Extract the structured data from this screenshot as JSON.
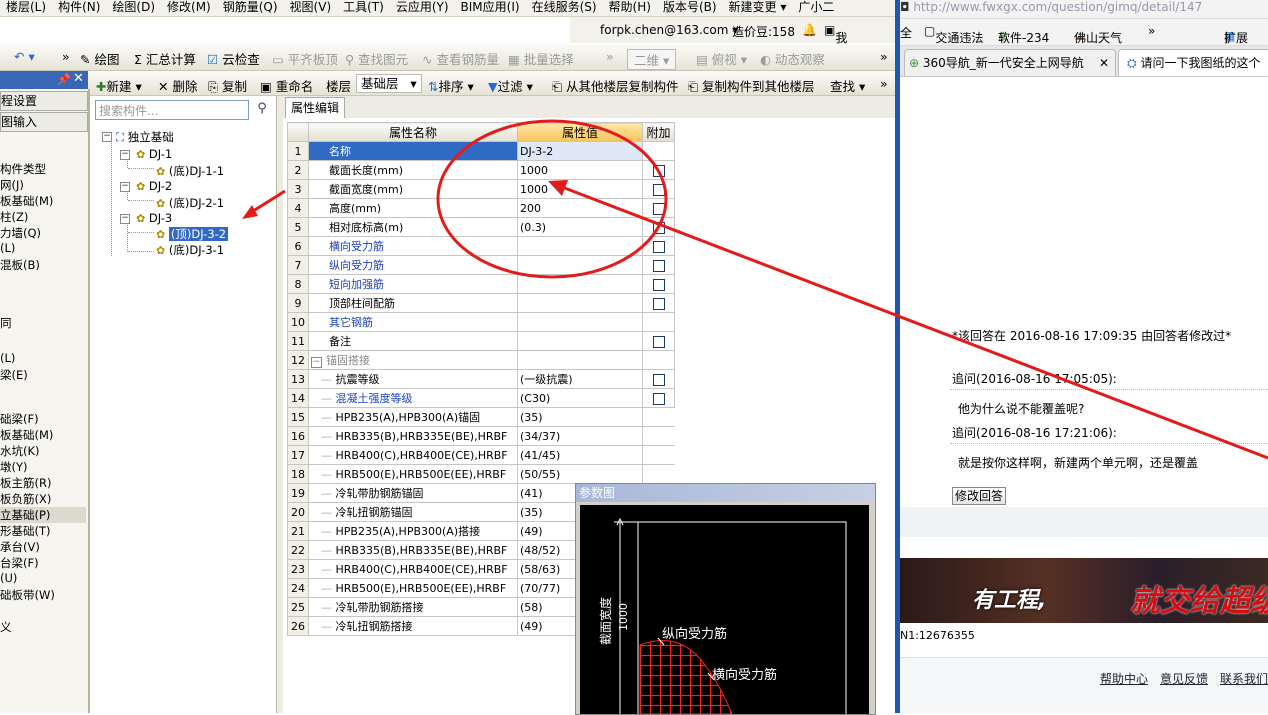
{
  "menubar": [
    "楼层(L)",
    "构件(N)",
    "绘图(D)",
    "修改(M)",
    "钢筋量(Q)",
    "视图(V)",
    "工具(T)",
    "云应用(Y)",
    "BIM应用(I)",
    "在线服务(S)",
    "帮助(H)",
    "版本号(B)",
    "新建变更 ▾",
    "广小二"
  ],
  "userbar": {
    "email": "forpk.chen@163.com ▾",
    "credit": "造价豆:158",
    "suggest": "我要建议"
  },
  "toolbar1": {
    "draw": "绘图",
    "sum": "Σ 汇总计算",
    "cloud_check": "云检查",
    "flat_slab": "平齐板顶",
    "find": "查找图元",
    "view_rebar": "查看钢筋量",
    "batch_select": "批量选择",
    "view_mode": "二维",
    "perspective": "俯视",
    "dynamic": "动态观察"
  },
  "toolbar2": {
    "new": "新建 ▾",
    "delete": "删除",
    "copy": "复制",
    "rename": "重命名",
    "floor_label": "楼层",
    "floor_value": "基础层",
    "sort": "排序 ▾",
    "filter": "过滤 ▾",
    "copy_from": "从其他楼层复制构件",
    "copy_to": "复制构件到其他楼层",
    "find": "查找 ▾"
  },
  "left_panel": {
    "setting": "程设置",
    "input": "图输入",
    "items": [
      "构件类型",
      "网(J)",
      "板基础(M)",
      "柱(Z)",
      "力墙(Q)",
      "(L)",
      "混板(B)",
      "同",
      "(L)",
      "梁(E)",
      "础梁(F)",
      "板基础(M)",
      "水坑(K)",
      "墩(Y)",
      "板主筋(R)",
      "板负筋(X)",
      "立基础(P)",
      "形基础(T)",
      "承台(V)",
      "台梁(F)",
      "(U)",
      "础板带(W)",
      "义"
    ]
  },
  "tree": {
    "search_placeholder": "搜索构件...",
    "root": "独立基础",
    "nodes": [
      "DJ-1",
      "(底)DJ-1-1",
      "DJ-2",
      "(底)DJ-2-1",
      "DJ-3",
      "(顶)DJ-3-2",
      "(底)DJ-3-1"
    ]
  },
  "tab_label": "属性编辑",
  "grid": {
    "headers": {
      "name": "属性名称",
      "value": "属性值",
      "extra": "附加"
    },
    "rows": [
      {
        "n": "1",
        "name": "名称",
        "value": "DJ-3-2",
        "chk": false,
        "style": "sel"
      },
      {
        "n": "2",
        "name": "截面长度(mm)",
        "value": "1000",
        "chk": true,
        "style": ""
      },
      {
        "n": "3",
        "name": "截面宽度(mm)",
        "value": "1000",
        "chk": true,
        "style": ""
      },
      {
        "n": "4",
        "name": "高度(mm)",
        "value": "200",
        "chk": true,
        "style": ""
      },
      {
        "n": "5",
        "name": "相对底标高(m)",
        "value": "(0.3)",
        "chk": true,
        "style": ""
      },
      {
        "n": "6",
        "name": "横向受力筋",
        "value": "",
        "chk": true,
        "style": "blue"
      },
      {
        "n": "7",
        "name": "纵向受力筋",
        "value": "",
        "chk": true,
        "style": "blue"
      },
      {
        "n": "8",
        "name": "短向加强筋",
        "value": "",
        "chk": true,
        "style": "blue"
      },
      {
        "n": "9",
        "name": "顶部柱间配筋",
        "value": "",
        "chk": true,
        "style": ""
      },
      {
        "n": "10",
        "name": "其它钢筋",
        "value": "",
        "chk": false,
        "style": "blue"
      },
      {
        "n": "11",
        "name": "备注",
        "value": "",
        "chk": true,
        "style": ""
      },
      {
        "n": "12",
        "name": "锚固搭接",
        "value": "",
        "chk": false,
        "style": "group"
      },
      {
        "n": "13",
        "name": "抗震等级",
        "value": "(一级抗震)",
        "chk": true,
        "style": "sub"
      },
      {
        "n": "14",
        "name": "混凝土强度等级",
        "value": "(C30)",
        "chk": true,
        "style": "subblue"
      },
      {
        "n": "15",
        "name": "HPB235(A),HPB300(A)锚固",
        "value": "(35)",
        "chk": false,
        "style": "sub"
      },
      {
        "n": "16",
        "name": "HRB335(B),HRB335E(BE),HRBF",
        "value": "(34/37)",
        "chk": false,
        "style": "sub"
      },
      {
        "n": "17",
        "name": "HRB400(C),HRB400E(CE),HRBF",
        "value": "(41/45)",
        "chk": false,
        "style": "sub"
      },
      {
        "n": "18",
        "name": "HRB500(E),HRB500E(EE),HRBF",
        "value": "(50/55)",
        "chk": false,
        "style": "sub"
      },
      {
        "n": "19",
        "name": "冷轧带肋钢筋锚固",
        "value": "(41)",
        "chk": false,
        "style": "sub"
      },
      {
        "n": "20",
        "name": "冷轧扭钢筋锚固",
        "value": "(35)",
        "chk": false,
        "style": "sub"
      },
      {
        "n": "21",
        "name": "HPB235(A),HPB300(A)搭接",
        "value": "(49)",
        "chk": false,
        "style": "sub"
      },
      {
        "n": "22",
        "name": "HRB335(B),HRB335E(BE),HRBF",
        "value": "(48/52)",
        "chk": false,
        "style": "sub"
      },
      {
        "n": "23",
        "name": "HRB400(C),HRB400E(CE),HRBF",
        "value": "(58/63)",
        "chk": false,
        "style": "sub"
      },
      {
        "n": "24",
        "name": "HRB500(E),HRB500E(EE),HRBF",
        "value": "(70/77)",
        "chk": false,
        "style": "sub"
      },
      {
        "n": "25",
        "name": "冷轧带肋钢筋搭接",
        "value": "(58)",
        "chk": false,
        "style": "sub"
      },
      {
        "n": "26",
        "name": "冷轧扭钢筋搭接",
        "value": "(49)",
        "chk": false,
        "style": "sub"
      }
    ]
  },
  "param": {
    "title": "参数图",
    "dim_label": "截面宽度",
    "dim_value": "1000",
    "label1": "纵向受力筋",
    "label2": "横向受力筋"
  },
  "browser": {
    "address": "http://www.fwxgx.com/question/gimq/detail/147",
    "favs": [
      "全",
      "交通违法",
      "软件-234",
      "佛山天气",
      "»",
      "扩展"
    ],
    "tab1": "360导航_新一代安全上网导航",
    "tab2": "请问一下我图纸的这个",
    "edited_note": "*该回答在 2016-08-16 17:09:35 由回答者修改过*",
    "q1_label": "追问(2016-08-16 17:05:05):",
    "q1_text": "他为什么说不能覆盖呢?",
    "q2_label": "追问(2016-08-16 17:21:06):",
    "q2_text": "就是按你这样啊，新建两个单元啊，还是覆盖",
    "modify_button": "修改回答",
    "banner_text1": "有工程,",
    "banner_text2": "就交给超级算",
    "code": "N1:12676355",
    "footer": [
      "帮助中心",
      "意见反馈",
      "联系我们"
    ]
  },
  "colors": {
    "annotation_red": "#e31b1b",
    "selection_blue": "#316ac5",
    "header_orange": "#f7c45a"
  }
}
